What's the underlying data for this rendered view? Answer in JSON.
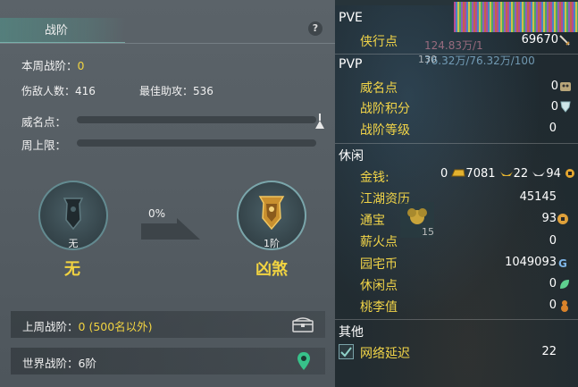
{
  "left": {
    "title": "战阶",
    "help": "?",
    "week_rank_label": "本周战阶：",
    "week_rank_value": "0",
    "kills_label": "伤敌人数：416",
    "assist_label": "最佳助攻：536",
    "prestige_label": "威名点：",
    "weekly_cap_label": "周上限：",
    "progress_percent": "0%",
    "current": {
      "sub": "无",
      "name": "无"
    },
    "next": {
      "sub": "1阶",
      "name": "凶煞"
    },
    "last_week_label": "上周战阶：",
    "last_week_value": "0 (500名以外)",
    "world_rank_label": "世界战阶：6阶"
  },
  "right": {
    "overlay_nums1": "124.83万/1",
    "overlay_nums2": "76.32万/76.32万/100",
    "overlay_130": "130",
    "pve": {
      "title": "PVE",
      "items": [
        {
          "label": "侠行点",
          "value": "69670",
          "icon": "sword-icon"
        }
      ]
    },
    "pvp": {
      "title": "PVP",
      "items": [
        {
          "label": "威名点",
          "value": "0",
          "icon": "mask-icon"
        },
        {
          "label": "战阶积分",
          "value": "0",
          "icon": "crest-icon"
        },
        {
          "label": "战阶等级",
          "value": "0"
        }
      ]
    },
    "leisure": {
      "title": "休闲",
      "money_label": "金钱:",
      "money": {
        "gold_bars": "0",
        "gold": "7081",
        "silver": "22",
        "copper": "94"
      },
      "items": [
        {
          "label": "江湖资历",
          "value": "45145"
        },
        {
          "label": "通宝",
          "value": "93",
          "icon": "coin-icon"
        },
        {
          "label": "薪火点",
          "value": "0"
        },
        {
          "label": "园宅币",
          "value": "1049093",
          "icon": "g-coin-icon"
        },
        {
          "label": "休闲点",
          "value": "0",
          "icon": "leaf-icon"
        },
        {
          "label": "桃李值",
          "value": "0",
          "icon": "gourd-icon"
        }
      ]
    },
    "other": {
      "title": "其他",
      "network_label": "网络延迟",
      "network_value": "22"
    },
    "colors": {
      "item_label": "#f2d548",
      "value": "#ffffff"
    }
  }
}
